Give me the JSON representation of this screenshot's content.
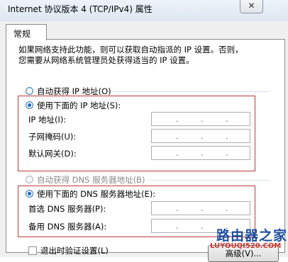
{
  "window": {
    "title": "Internet 协议版本 4 (TCP/IPv4) 属性",
    "close_label": "✕"
  },
  "tabs": [
    {
      "label": "常规"
    }
  ],
  "description": "如果网络支持此功能，则可以获取自动指派的 IP 设置。否则，\n您需要从网络系统管理员处获得适当的 IP 设置。",
  "ip_section": {
    "auto_label": "自动获得 IP 地址(O)",
    "manual_label": "使用下面的 IP 地址(S):",
    "selected": "manual",
    "fields": [
      {
        "label": "IP 地址(I):",
        "value": ""
      },
      {
        "label": "子网掩码(U):",
        "value": ""
      },
      {
        "label": "默认网关(D):",
        "value": ""
      }
    ]
  },
  "dns_section": {
    "auto_label": "自动获得 DNS 服务器地址(B)",
    "manual_label": "使用下面的 DNS 服务器地址(E):",
    "selected": "manual",
    "auto_disabled": true,
    "fields": [
      {
        "label": "首选 DNS 服务器(P):",
        "value": ""
      },
      {
        "label": "备用 DNS 服务器(A):",
        "value": ""
      }
    ]
  },
  "validate_on_exit": {
    "label": "退出时验证设置(L)",
    "checked": false
  },
  "advanced_button": {
    "label": "高级(V)..."
  },
  "watermark": {
    "text": "路由器之家",
    "url": "LUYOUQI520.COM"
  },
  "colors": {
    "highlight_box": "#c0393b",
    "radio_selected": "#1c6bd0"
  }
}
